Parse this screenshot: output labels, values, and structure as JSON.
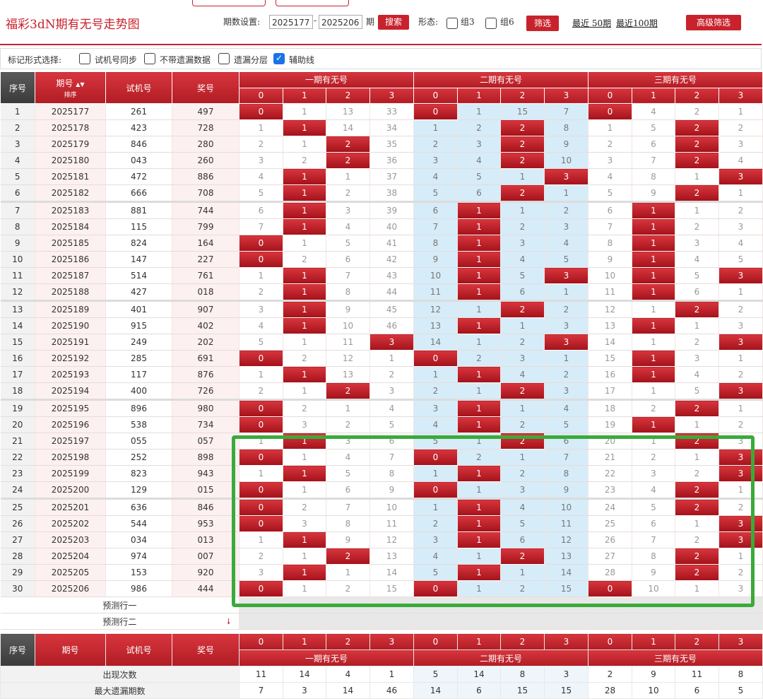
{
  "header": {
    "title": "福彩3dN期有无号走势图",
    "period_label": "期数设置:",
    "period_from": "2025177",
    "dash": "-",
    "period_to": "2025206",
    "period_unit": "期",
    "search_btn": "搜索",
    "form_label": "形态:",
    "group3": "组3",
    "group6": "组6",
    "filter_btn": "筛选",
    "recent50": "最近 50期",
    "recent100": "最近100期",
    "advanced_btn": "高级筛选"
  },
  "options": {
    "label": "标记形式选择:",
    "items": [
      {
        "text": "试机号同步",
        "checked": false
      },
      {
        "text": "不带遗漏数据",
        "checked": false
      },
      {
        "text": "遗漏分层",
        "checked": false
      },
      {
        "text": "辅助线",
        "checked": true
      }
    ]
  },
  "table_header": {
    "seq": "序号",
    "period": "期号",
    "sort": "排序",
    "trial": "试机号",
    "prize": "奖号",
    "groups": [
      "一期有无号",
      "二期有无号",
      "三期有无号"
    ],
    "digits": [
      "0",
      "1",
      "2",
      "3"
    ]
  },
  "rows": [
    {
      "seq": "1",
      "period": "2025177",
      "trial": "261",
      "prize": "497",
      "g1": [
        "0",
        "1",
        "13",
        "33"
      ],
      "g2": [
        "0",
        "1",
        "15",
        "7"
      ],
      "g3": [
        "0",
        "4",
        "2",
        "1"
      ]
    },
    {
      "seq": "2",
      "period": "2025178",
      "trial": "423",
      "prize": "728",
      "g1": [
        "1",
        "1",
        "14",
        "34"
      ],
      "g2": [
        "1",
        "2",
        "2",
        "8"
      ],
      "g3": [
        "1",
        "5",
        "2",
        "2"
      ]
    },
    {
      "seq": "3",
      "period": "2025179",
      "trial": "846",
      "prize": "280",
      "g1": [
        "2",
        "1",
        "2",
        "35"
      ],
      "g2": [
        "2",
        "3",
        "2",
        "9"
      ],
      "g3": [
        "2",
        "6",
        "2",
        "3"
      ]
    },
    {
      "seq": "4",
      "period": "2025180",
      "trial": "043",
      "prize": "260",
      "g1": [
        "3",
        "2",
        "2",
        "36"
      ],
      "g2": [
        "3",
        "4",
        "2",
        "10"
      ],
      "g3": [
        "3",
        "7",
        "2",
        "4"
      ]
    },
    {
      "seq": "5",
      "period": "2025181",
      "trial": "472",
      "prize": "886",
      "g1": [
        "4",
        "1",
        "1",
        "37"
      ],
      "g2": [
        "4",
        "5",
        "1",
        "3"
      ],
      "g3": [
        "4",
        "8",
        "1",
        "3"
      ]
    },
    {
      "seq": "6",
      "period": "2025182",
      "trial": "666",
      "prize": "708",
      "g1": [
        "5",
        "1",
        "2",
        "38"
      ],
      "g2": [
        "5",
        "6",
        "2",
        "1"
      ],
      "g3": [
        "5",
        "9",
        "2",
        "1"
      ]
    },
    {
      "seq": "7",
      "period": "2025183",
      "trial": "881",
      "prize": "744",
      "g1": [
        "6",
        "1",
        "3",
        "39"
      ],
      "g2": [
        "6",
        "1",
        "1",
        "2"
      ],
      "g3": [
        "6",
        "1",
        "1",
        "2"
      ]
    },
    {
      "seq": "8",
      "period": "2025184",
      "trial": "115",
      "prize": "799",
      "g1": [
        "7",
        "1",
        "4",
        "40"
      ],
      "g2": [
        "7",
        "1",
        "2",
        "3"
      ],
      "g3": [
        "7",
        "1",
        "2",
        "3"
      ]
    },
    {
      "seq": "9",
      "period": "2025185",
      "trial": "824",
      "prize": "164",
      "g1": [
        "0",
        "1",
        "5",
        "41"
      ],
      "g2": [
        "8",
        "1",
        "3",
        "4"
      ],
      "g3": [
        "8",
        "1",
        "3",
        "4"
      ]
    },
    {
      "seq": "10",
      "period": "2025186",
      "trial": "147",
      "prize": "227",
      "g1": [
        "0",
        "2",
        "6",
        "42"
      ],
      "g2": [
        "9",
        "1",
        "4",
        "5"
      ],
      "g3": [
        "9",
        "1",
        "4",
        "5"
      ]
    },
    {
      "seq": "11",
      "period": "2025187",
      "trial": "514",
      "prize": "761",
      "g1": [
        "1",
        "1",
        "7",
        "43"
      ],
      "g2": [
        "10",
        "1",
        "5",
        "3"
      ],
      "g3": [
        "10",
        "1",
        "5",
        "3"
      ]
    },
    {
      "seq": "12",
      "period": "2025188",
      "trial": "427",
      "prize": "018",
      "g1": [
        "2",
        "1",
        "8",
        "44"
      ],
      "g2": [
        "11",
        "1",
        "6",
        "1"
      ],
      "g3": [
        "11",
        "1",
        "6",
        "1"
      ]
    },
    {
      "seq": "13",
      "period": "2025189",
      "trial": "401",
      "prize": "907",
      "g1": [
        "3",
        "1",
        "9",
        "45"
      ],
      "g2": [
        "12",
        "1",
        "2",
        "2"
      ],
      "g3": [
        "12",
        "1",
        "2",
        "2"
      ]
    },
    {
      "seq": "14",
      "period": "2025190",
      "trial": "915",
      "prize": "402",
      "g1": [
        "4",
        "1",
        "10",
        "46"
      ],
      "g2": [
        "13",
        "1",
        "1",
        "3"
      ],
      "g3": [
        "13",
        "1",
        "1",
        "3"
      ]
    },
    {
      "seq": "15",
      "period": "2025191",
      "trial": "249",
      "prize": "202",
      "g1": [
        "5",
        "1",
        "11",
        "3"
      ],
      "g2": [
        "14",
        "1",
        "2",
        "3"
      ],
      "g3": [
        "14",
        "1",
        "2",
        "3"
      ]
    },
    {
      "seq": "16",
      "period": "2025192",
      "trial": "285",
      "prize": "691",
      "g1": [
        "0",
        "2",
        "12",
        "1"
      ],
      "g2": [
        "0",
        "2",
        "3",
        "1"
      ],
      "g3": [
        "15",
        "1",
        "3",
        "1"
      ]
    },
    {
      "seq": "17",
      "period": "2025193",
      "trial": "117",
      "prize": "876",
      "g1": [
        "1",
        "1",
        "13",
        "2"
      ],
      "g2": [
        "1",
        "1",
        "4",
        "2"
      ],
      "g3": [
        "16",
        "1",
        "4",
        "2"
      ]
    },
    {
      "seq": "18",
      "period": "2025194",
      "trial": "400",
      "prize": "726",
      "g1": [
        "2",
        "1",
        "2",
        "3"
      ],
      "g2": [
        "2",
        "1",
        "2",
        "3"
      ],
      "g3": [
        "17",
        "1",
        "5",
        "3"
      ]
    },
    {
      "seq": "19",
      "period": "2025195",
      "trial": "896",
      "prize": "980",
      "g1": [
        "0",
        "2",
        "1",
        "4"
      ],
      "g2": [
        "3",
        "1",
        "1",
        "4"
      ],
      "g3": [
        "18",
        "2",
        "2",
        "1"
      ]
    },
    {
      "seq": "20",
      "period": "2025196",
      "trial": "538",
      "prize": "734",
      "g1": [
        "0",
        "3",
        "2",
        "5"
      ],
      "g2": [
        "4",
        "1",
        "2",
        "5"
      ],
      "g3": [
        "19",
        "1",
        "1",
        "2"
      ]
    },
    {
      "seq": "21",
      "period": "2025197",
      "trial": "055",
      "prize": "057",
      "g1": [
        "1",
        "1",
        "3",
        "6"
      ],
      "g2": [
        "5",
        "1",
        "2",
        "6"
      ],
      "g3": [
        "20",
        "1",
        "2",
        "3"
      ]
    },
    {
      "seq": "22",
      "period": "2025198",
      "trial": "252",
      "prize": "898",
      "g1": [
        "0",
        "1",
        "4",
        "7"
      ],
      "g2": [
        "0",
        "2",
        "1",
        "7"
      ],
      "g3": [
        "21",
        "2",
        "1",
        "3"
      ]
    },
    {
      "seq": "23",
      "period": "2025199",
      "trial": "823",
      "prize": "943",
      "g1": [
        "1",
        "1",
        "5",
        "8"
      ],
      "g2": [
        "1",
        "1",
        "2",
        "8"
      ],
      "g3": [
        "22",
        "3",
        "2",
        "3"
      ]
    },
    {
      "seq": "24",
      "period": "2025200",
      "trial": "129",
      "prize": "015",
      "g1": [
        "0",
        "1",
        "6",
        "9"
      ],
      "g2": [
        "0",
        "1",
        "3",
        "9"
      ],
      "g3": [
        "23",
        "4",
        "2",
        "1"
      ]
    },
    {
      "seq": "25",
      "period": "2025201",
      "trial": "636",
      "prize": "846",
      "g1": [
        "0",
        "2",
        "7",
        "10"
      ],
      "g2": [
        "1",
        "1",
        "4",
        "10"
      ],
      "g3": [
        "24",
        "5",
        "2",
        "2"
      ]
    },
    {
      "seq": "26",
      "period": "2025202",
      "trial": "544",
      "prize": "953",
      "g1": [
        "0",
        "3",
        "8",
        "11"
      ],
      "g2": [
        "2",
        "1",
        "5",
        "11"
      ],
      "g3": [
        "25",
        "6",
        "1",
        "3"
      ]
    },
    {
      "seq": "27",
      "period": "2025203",
      "trial": "034",
      "prize": "013",
      "g1": [
        "1",
        "1",
        "9",
        "12"
      ],
      "g2": [
        "3",
        "1",
        "6",
        "12"
      ],
      "g3": [
        "26",
        "7",
        "2",
        "3"
      ]
    },
    {
      "seq": "28",
      "period": "2025204",
      "trial": "974",
      "prize": "007",
      "g1": [
        "2",
        "1",
        "2",
        "13"
      ],
      "g2": [
        "4",
        "1",
        "2",
        "13"
      ],
      "g3": [
        "27",
        "8",
        "2",
        "1"
      ]
    },
    {
      "seq": "29",
      "period": "2025205",
      "trial": "153",
      "prize": "920",
      "g1": [
        "3",
        "1",
        "1",
        "14"
      ],
      "g2": [
        "5",
        "1",
        "1",
        "14"
      ],
      "g3": [
        "28",
        "9",
        "2",
        "2"
      ]
    },
    {
      "seq": "30",
      "period": "2025206",
      "trial": "986",
      "prize": "444",
      "g1": [
        "0",
        "1",
        "2",
        "15"
      ],
      "g2": [
        "0",
        "1",
        "2",
        "15"
      ],
      "g3": [
        "0",
        "10",
        "1",
        "3"
      ]
    }
  ],
  "hits": {
    "g1": [
      [
        0
      ],
      [
        1
      ],
      [
        2
      ],
      [
        2
      ],
      [
        1
      ],
      [
        1
      ],
      [
        1
      ],
      [
        1
      ],
      [
        0
      ],
      [
        0
      ],
      [
        1
      ],
      [
        1
      ],
      [
        1
      ],
      [
        1
      ],
      [
        3
      ],
      [
        0
      ],
      [
        1
      ],
      [
        2
      ],
      [
        0
      ],
      [
        0
      ],
      [
        1
      ],
      [
        0
      ],
      [
        1
      ],
      [
        0
      ],
      [
        0
      ],
      [
        0
      ],
      [
        1
      ],
      [
        2
      ],
      [
        1
      ],
      [
        0
      ]
    ],
    "g2": [
      [
        0
      ],
      [
        2
      ],
      [
        2
      ],
      [
        2
      ],
      [
        3
      ],
      [
        2
      ],
      [
        1
      ],
      [
        1
      ],
      [
        1
      ],
      [
        1
      ],
      [
        1,
        3
      ],
      [
        1
      ],
      [
        2
      ],
      [
        1
      ],
      [
        3
      ],
      [
        0
      ],
      [
        1
      ],
      [
        2
      ],
      [
        1
      ],
      [
        1
      ],
      [
        2
      ],
      [
        0
      ],
      [
        1
      ],
      [
        0
      ],
      [
        1
      ],
      [
        1
      ],
      [
        1
      ],
      [
        2
      ],
      [
        1
      ],
      [
        0
      ]
    ],
    "g3": [
      [
        0
      ],
      [
        2
      ],
      [
        2
      ],
      [
        2
      ],
      [
        3
      ],
      [
        2
      ],
      [
        1
      ],
      [
        1
      ],
      [
        1
      ],
      [
        1
      ],
      [
        1,
        3
      ],
      [
        1
      ],
      [
        2
      ],
      [
        1
      ],
      [
        3
      ],
      [
        1
      ],
      [
        1
      ],
      [
        3
      ],
      [
        2
      ],
      [
        1
      ],
      [
        2
      ],
      [
        3
      ],
      [
        3
      ],
      [
        2
      ],
      [
        2
      ],
      [
        3
      ],
      [
        3
      ],
      [
        2
      ],
      [
        2
      ],
      [
        0
      ]
    ]
  },
  "predict": [
    "预测行一",
    "预测行二"
  ],
  "footer": {
    "seq": "序号",
    "period": "期号",
    "trial": "试机号",
    "prize": "奖号",
    "groups": [
      "一期有无号",
      "二期有无号",
      "三期有无号"
    ],
    "digits": [
      "0",
      "1",
      "2",
      "3"
    ],
    "stats": [
      {
        "label": "出现次数",
        "values": [
          "11",
          "14",
          "4",
          "1",
          "5",
          "14",
          "8",
          "3",
          "2",
          "9",
          "11",
          "8"
        ]
      },
      {
        "label": "最大遗漏期数",
        "values": [
          "7",
          "3",
          "14",
          "46",
          "14",
          "6",
          "15",
          "15",
          "28",
          "10",
          "6",
          "5"
        ]
      }
    ]
  },
  "colors": {
    "accent": "#c8232c",
    "group2_bg": "#d6ecf8",
    "highlight_box": "#3aaa3a"
  }
}
